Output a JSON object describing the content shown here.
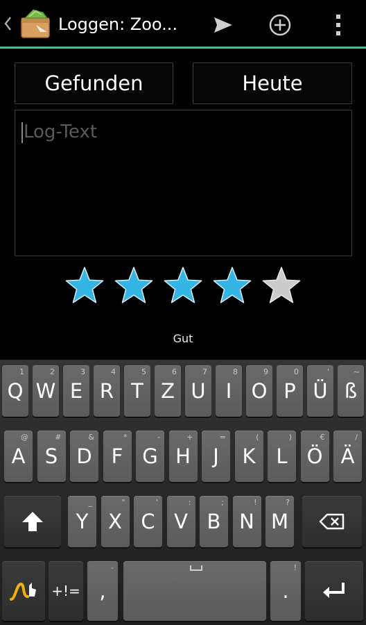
{
  "actionbar": {
    "title": "Loggen: Zoo...",
    "accent_color": "#2fd08f",
    "icons": [
      "up-caret-icon",
      "app-icon",
      "send-icon",
      "add-circle-icon",
      "overflow-menu-icon"
    ]
  },
  "form": {
    "log_type_button": "Gefunden",
    "date_button": "Heute",
    "log_text_placeholder": "Log-Text"
  },
  "rating": {
    "value": 4,
    "max": 5,
    "label": "Gut",
    "filled_color": "#33b5e5",
    "empty_color": "#cccccc"
  },
  "keyboard": {
    "row1": [
      {
        "label": "Q",
        "hint": "1"
      },
      {
        "label": "W",
        "hint": "2"
      },
      {
        "label": "E",
        "hint": "3"
      },
      {
        "label": "R",
        "hint": "4"
      },
      {
        "label": "T",
        "hint": "5"
      },
      {
        "label": "Z",
        "hint": "6"
      },
      {
        "label": "U",
        "hint": "7"
      },
      {
        "label": "I",
        "hint": "8"
      },
      {
        "label": "O",
        "hint": "9"
      },
      {
        "label": "P",
        "hint": "0"
      },
      {
        "label": "Ü",
        "hint": "'"
      },
      {
        "label": "ß",
        "hint": "~"
      }
    ],
    "row2": [
      {
        "label": "A",
        "hint": "@"
      },
      {
        "label": "S",
        "hint": "#"
      },
      {
        "label": "D",
        "hint": "&"
      },
      {
        "label": "F",
        "hint": "*"
      },
      {
        "label": "G",
        "hint": "-"
      },
      {
        "label": "H",
        "hint": "+"
      },
      {
        "label": "J",
        "hint": "="
      },
      {
        "label": "K",
        "hint": "("
      },
      {
        "label": "L",
        "hint": ")"
      },
      {
        "label": "Ö",
        "hint": "€"
      },
      {
        "label": "Ä",
        "hint": "/"
      }
    ],
    "row3": [
      {
        "label": "Y",
        "hint": "_"
      },
      {
        "label": "X",
        "hint": "\""
      },
      {
        "label": "C",
        "hint": "'"
      },
      {
        "label": "V",
        "hint": ":"
      },
      {
        "label": "B",
        "hint": ";"
      },
      {
        "label": "N",
        "hint": "!"
      },
      {
        "label": "M",
        "hint": "?"
      }
    ],
    "symbols_key": "+!=",
    "comma_key": ",",
    "comma_hint": "-",
    "period_key": ".",
    "period_hint": "!"
  }
}
